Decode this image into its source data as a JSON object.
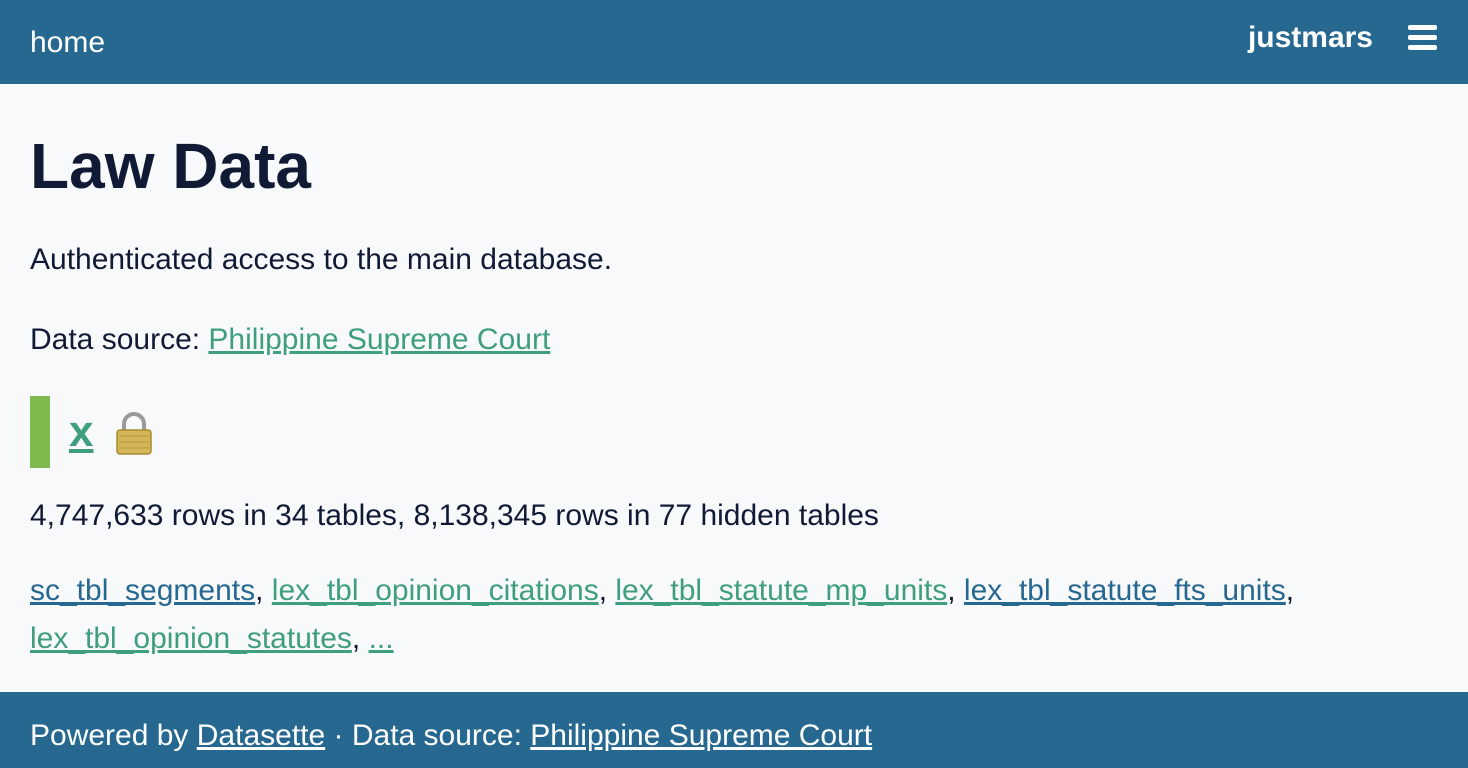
{
  "header": {
    "home_label": "home",
    "username": "justmars",
    "menu_icon": "hamburger-icon"
  },
  "page": {
    "title": "Law Data",
    "description": "Authenticated access to the main database.",
    "source_prefix": "Data source: ",
    "source_link": "Philippine Supreme Court"
  },
  "database": {
    "name": "x",
    "color": "#7dbb4e",
    "lock_icon": "lock-icon",
    "stats": "4,747,633 rows in 34 tables, 8,138,345 rows in 77 hidden tables",
    "tables": [
      {
        "name": "sc_tbl_segments",
        "color": "#276890"
      },
      {
        "name": "lex_tbl_opinion_citations",
        "color": "#3f9e7c"
      },
      {
        "name": "lex_tbl_statute_mp_units",
        "color": "#3f9e7c"
      },
      {
        "name": "lex_tbl_statute_fts_units",
        "color": "#276890"
      },
      {
        "name": "lex_tbl_opinion_statutes",
        "color": "#3f9e7c"
      }
    ],
    "more_label": "...",
    "separator": ", "
  },
  "footer": {
    "powered_prefix": "Powered by ",
    "datasette_link": "Datasette",
    "source_prefix": " · Data source: ",
    "source_link": "Philippine Supreme Court"
  },
  "colors": {
    "header_bg": "#276890",
    "link_green": "#3f9e7c",
    "link_blue": "#276890",
    "text": "#111a35",
    "background": "#f8f9fb"
  }
}
